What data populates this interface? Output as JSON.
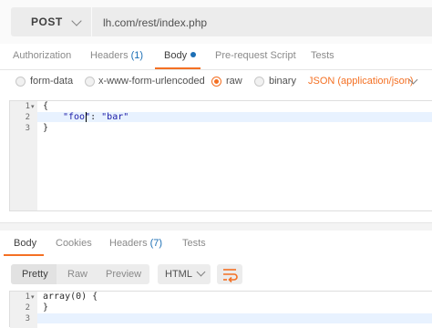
{
  "request": {
    "method": "POST",
    "url": "lh.com/rest/index.php"
  },
  "request_tabs": [
    {
      "label": "Authorization"
    },
    {
      "label": "Headers",
      "count": "(1)"
    },
    {
      "label": "Body",
      "active": true
    },
    {
      "label": "Pre-request Script"
    },
    {
      "label": "Tests"
    }
  ],
  "body_types": {
    "form_data": "form-data",
    "urlencoded": "x-www-form-urlencoded",
    "raw": "raw",
    "binary": "binary",
    "selected": "raw",
    "content_type": "JSON (application/json)"
  },
  "request_editor": {
    "lines": [
      "1",
      "2",
      "3"
    ],
    "line1": "{",
    "key": "\"foo\"",
    "sep": ": ",
    "value": "\"bar\"",
    "line3": "}"
  },
  "response_tabs": [
    {
      "label": "Body",
      "active": true
    },
    {
      "label": "Cookies"
    },
    {
      "label": "Headers",
      "count": "(7)"
    },
    {
      "label": "Tests"
    }
  ],
  "response_toolbar": {
    "pretty": "Pretty",
    "raw": "Raw",
    "preview": "Preview",
    "format": "HTML"
  },
  "response_editor": {
    "lines": [
      "1",
      "2",
      "3"
    ],
    "line1": "array(0) {",
    "line2": "}",
    "line3": ""
  },
  "colors": {
    "accent": "#f47023",
    "count_blue": "#1c6fb5"
  },
  "icons": {
    "method_dropdown": "chevron-down-icon",
    "content_type_dropdown": "chevron-down-icon",
    "fold": "fold-triangle-icon",
    "wrap": "wrap-lines-icon"
  }
}
